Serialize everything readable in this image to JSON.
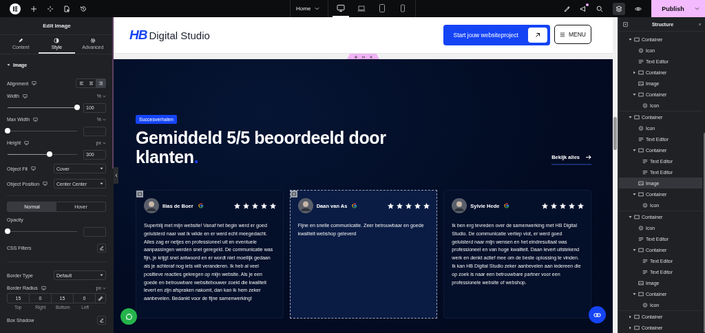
{
  "topbar": {
    "page_selector": "Home",
    "devices": [
      {
        "kind": "desktop",
        "selected": true
      },
      {
        "kind": "laptop",
        "selected": false
      },
      {
        "kind": "tablet",
        "selected": false
      },
      {
        "kind": "mobile",
        "selected": false
      }
    ],
    "notification": true,
    "structure_open": true,
    "publish": "Publish"
  },
  "editor_panel": {
    "title": "Edit Image",
    "tabs": [
      {
        "label": "Content",
        "kind": "pencil",
        "selected": false
      },
      {
        "label": "Style",
        "kind": "contrast",
        "selected": true
      },
      {
        "label": "Advanced",
        "kind": "gear",
        "selected": false
      }
    ],
    "section": "Image",
    "controls": [
      {
        "kind": "alignment",
        "label": "Alignment",
        "responsive": true,
        "options": [
          {
            "selected": false
          },
          {
            "selected": false
          },
          {
            "selected": true
          }
        ]
      },
      {
        "kind": "slider",
        "label": "Width",
        "responsive": true,
        "unit": "%",
        "level": 1,
        "value": "100"
      },
      {
        "kind": "slider",
        "label": "Max Width",
        "responsive": true,
        "unit": "%",
        "level": 0
      },
      {
        "kind": "slider",
        "label": "Height",
        "responsive": true,
        "unit": "px",
        "level": 0.6,
        "value": "300"
      },
      {
        "kind": "select",
        "label": "Object Fit",
        "responsive": true,
        "value": "Cover"
      },
      {
        "kind": "select",
        "label": "Object Position",
        "responsive": true,
        "value": "Center Center"
      },
      {
        "kind": "divider"
      },
      {
        "kind": "state_tabs",
        "tabs": [
          {
            "label": "Normal",
            "selected": true
          },
          {
            "label": "Hover",
            "selected": false
          }
        ]
      },
      {
        "kind": "slider",
        "label": "Opacity",
        "level": 0
      },
      {
        "kind": "button",
        "label": "CSS Filters"
      },
      {
        "kind": "divider"
      },
      {
        "kind": "select",
        "label": "Border Type",
        "value": "Default"
      },
      {
        "kind": "dimensions",
        "label": "Border Radius",
        "responsive": true,
        "unit": "px",
        "values": [
          {
            "value": "15",
            "caption": "Top"
          },
          {
            "value": "0",
            "caption": "Right"
          },
          {
            "value": "15",
            "caption": "Bottom"
          },
          {
            "value": "0",
            "caption": "Left"
          }
        ]
      },
      {
        "kind": "button",
        "label": "Box Shadow"
      }
    ]
  },
  "canvas": {
    "header": {
      "logo_mark": "HB",
      "logo_name": "Digital Studio",
      "cta": "Start jouw websiteproject",
      "menu": "MENU"
    },
    "section": {
      "badge": "Succesverhalen",
      "heading": "Gemiddeld 5/5 beoordeeld door klanten",
      "heading_accent": ".",
      "link": "Bekijk alles",
      "reviews": [
        {
          "name": "Ilias de Boer",
          "stars": 5,
          "selected": false,
          "handle": true,
          "text": "Superblij met mijn website! Vanaf het begin werd er goed geluisterd naar wat ik wilde en er werd echt meegedacht. Alles zag er netjes en professioneel uit en eventuele aanpassingen werden snel geregeld. De communicatie was fijn, je krijgt snel antwoord en er wordt niet moeilijk gedaan als je achteraf nog iets wilt veranderen. Ik heb al veel positieve reacties gekregen op mijn website. Als je een goede en betrouwbare websitebouwer zoekt die kwaliteit levert en zijn afspraken nakomt, dan kan ik hem zeker aanbevelen. Bedankt voor de fijne samenwerking!"
        },
        {
          "name": "Daan van As",
          "stars": 5,
          "selected": true,
          "handle": true,
          "text": "Fijne en snelle communicatie. Zeer betrouwbaar en goede kwaliteit webshop geleverd"
        },
        {
          "name": "Sylvie Hede",
          "stars": 5,
          "selected": false,
          "handle": false,
          "text": "Ik ben erg tevreden over de samenwerking met HB Digital Studio. De communicatie verliep vlot, er werd goed geluisterd naar mijn wensen en het eindresultaat was professioneel en van hoge kwaliteit. Daan levert uitstekend werk en denkt actief mee om de beste oplossing te vinden. Ik kan HB Digital Studio zeker aanbevelen aan iedereen die op zoek is naar een betrouwbare partner voor een professionele website of webshop."
        }
      ]
    }
  },
  "structure": {
    "title": "Structure",
    "tree": [
      {
        "label": "Container",
        "kind": "container",
        "expanded": true,
        "selected": false,
        "children": [
          {
            "label": "Icon",
            "kind": "icon",
            "selected": false
          },
          {
            "label": "Text Editor",
            "kind": "text",
            "selected": false
          },
          {
            "label": "Container",
            "kind": "container",
            "expanded": false,
            "selected": false
          },
          {
            "label": "Image",
            "kind": "image",
            "selected": false
          },
          {
            "label": "Container",
            "kind": "container",
            "expanded": true,
            "selected": false,
            "children": [
              {
                "label": "Icon",
                "kind": "icon",
                "selected": false
              }
            ]
          }
        ]
      },
      {
        "label": "Container",
        "kind": "container",
        "expanded": true,
        "selected": false,
        "children": [
          {
            "label": "Icon",
            "kind": "icon",
            "selected": false
          },
          {
            "label": "Text Editor",
            "kind": "text",
            "selected": false
          },
          {
            "label": "Container",
            "kind": "container",
            "expanded": true,
            "selected": false,
            "children": [
              {
                "label": "Text Editor",
                "kind": "text",
                "selected": false
              },
              {
                "label": "Text Editor",
                "kind": "text",
                "selected": false
              }
            ]
          },
          {
            "label": "Image",
            "kind": "image",
            "selected": true
          },
          {
            "label": "Container",
            "kind": "container",
            "expanded": true,
            "selected": false,
            "children": [
              {
                "label": "Icon",
                "kind": "icon",
                "selected": false
              }
            ]
          }
        ]
      },
      {
        "label": "Container",
        "kind": "container",
        "expanded": true,
        "selected": false,
        "children": [
          {
            "label": "Icon",
            "kind": "icon",
            "selected": false
          },
          {
            "label": "Text Editor",
            "kind": "text",
            "selected": false
          },
          {
            "label": "Container",
            "kind": "container",
            "expanded": true,
            "selected": false,
            "children": [
              {
                "label": "Text Editor",
                "kind": "text",
                "selected": false
              },
              {
                "label": "Text Editor",
                "kind": "text",
                "selected": false
              }
            ]
          },
          {
            "label": "Image",
            "kind": "image",
            "selected": false
          },
          {
            "label": "Container",
            "kind": "container",
            "expanded": true,
            "selected": false,
            "children": [
              {
                "label": "Icon",
                "kind": "icon",
                "selected": false
              }
            ]
          }
        ]
      },
      {
        "label": "Container",
        "kind": "container",
        "expanded": false,
        "selected": false
      },
      {
        "label": "Container",
        "kind": "container",
        "expanded": false,
        "selected": false
      }
    ]
  }
}
